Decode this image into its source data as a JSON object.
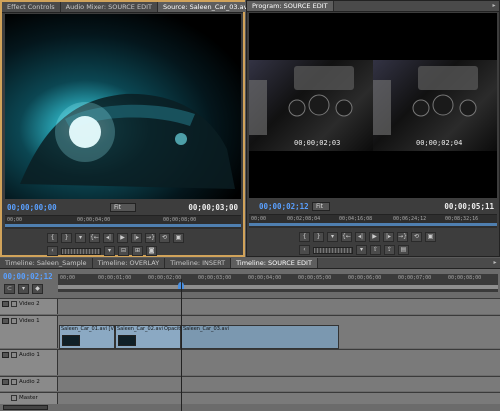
{
  "source_panel": {
    "tabs": [
      "Effect Controls",
      "Audio Mixer: SOURCE EDIT",
      "Source: Saleen_Car_03.avi"
    ],
    "timecode_current": "00;00;00;00",
    "timecode_duration": "00;00;03;00",
    "fit": "Fit",
    "ruler_labels": [
      "00;00",
      "00;00;04;00",
      "00;00;08;00"
    ]
  },
  "program_panel": {
    "tabs": [
      "Program: SOURCE EDIT"
    ],
    "overlay_left": "00;00;02;03",
    "overlay_right": "00;00;02;04",
    "timecode_current": "00;00;02;12",
    "timecode_duration": "00;00;05;11",
    "fit": "Fit",
    "ruler_labels": [
      "00;00",
      "00;02;08;04",
      "00;04;16;08",
      "00;06;24;12",
      "00;08;32;16"
    ]
  },
  "timeline": {
    "tabs": [
      "Timeline: Saleen_Sample",
      "Timeline: OVERLAY",
      "Timeline: INSERT",
      "Timeline: SOURCE EDIT"
    ],
    "timecode": "00;00;02;12",
    "ruler_labels": [
      "00;00",
      "00;00;01;00",
      "00;00;02;00",
      "00;00;03;00",
      "00;00;04;00",
      "00;00;05;00",
      "00;00;06;00",
      "00;00;07;00",
      "00;00;08;00"
    ],
    "tracks": [
      "Video 2",
      "Video 1",
      "Audio 1",
      "Audio 2",
      "Master"
    ],
    "clips": [
      "Saleen_Car_01.avi [V]",
      "Saleen_Car_02.avi",
      "Opacity",
      "Saleen_Car_03.avi"
    ]
  },
  "colors": {
    "timecode_blue": "#5aa0ff",
    "clip_blue": "#8ba9c3",
    "panel_bg": "#3d3d3d"
  }
}
